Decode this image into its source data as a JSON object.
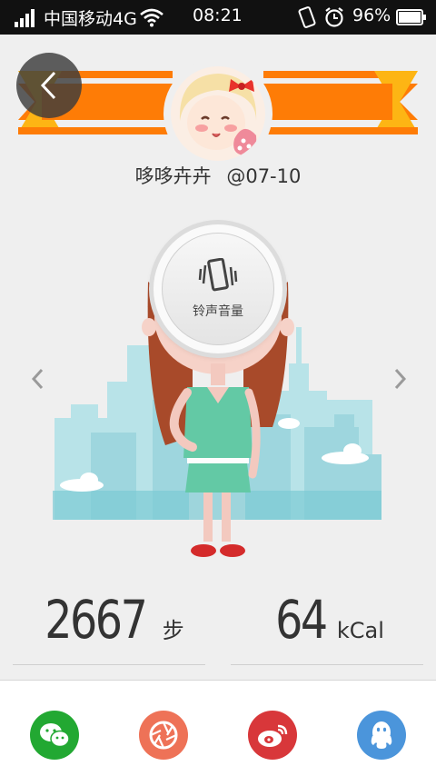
{
  "status_bar": {
    "carrier": "中国移动4G",
    "time": "08:21",
    "battery": "96%"
  },
  "header": {
    "username": "哆哆卉卉",
    "date": "@07-10"
  },
  "ringtone": {
    "label": "铃声音量"
  },
  "stats": {
    "steps_value": "2667",
    "steps_unit": "步",
    "calories_value": "64",
    "calories_unit": "kCal"
  },
  "share": {
    "items": [
      "wechat-icon",
      "camera-shutter-icon",
      "weibo-icon",
      "qq-icon"
    ],
    "colors": {
      "wechat": "#22a832",
      "camera": "#ee7257",
      "weibo": "#d8373a",
      "qq": "#4b95db"
    }
  },
  "colors": {
    "ribbon": "#fe7c06",
    "ribbon_light": "#fdb514",
    "background": "#efefef"
  }
}
